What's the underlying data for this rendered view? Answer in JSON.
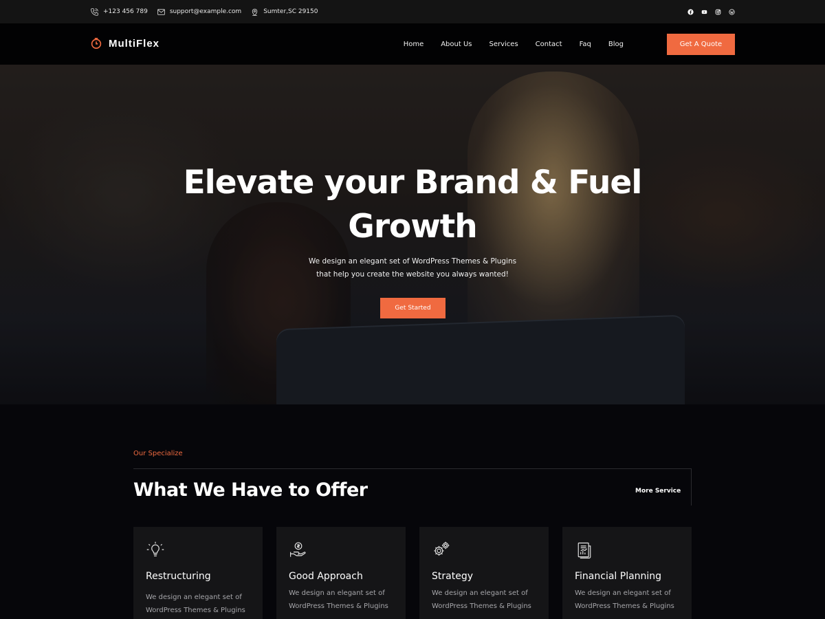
{
  "topbar": {
    "phone": "+123 456 789",
    "email": "support@example.com",
    "address": "Sumter,SC 29150",
    "social_icons": [
      "facebook-icon",
      "youtube-icon",
      "instagram-icon",
      "wordpress-icon"
    ]
  },
  "header": {
    "brand": "MultiFlex",
    "nav": [
      "Home",
      "About Us",
      "Services",
      "Contact",
      "Faq",
      "Blog"
    ],
    "cta_label": "Get A Quote"
  },
  "hero": {
    "title_line1": "Elevate your Brand & Fuel",
    "title_line2": "Growth",
    "subtitle_line1": "We design an elegant set of WordPress Themes & Plugins",
    "subtitle_line2": "that help you create the website you always wanted!",
    "button_label": "Get Started"
  },
  "services": {
    "eyebrow": "Our Specialize",
    "title": "What We Have to Offer",
    "more_label": "More Service",
    "cards": [
      {
        "title": "Restructuring",
        "desc_line1": "We design an elegant set of",
        "desc_line2": "WordPress Themes & Plugins",
        "icon": "lightbulb-icon"
      },
      {
        "title": "Good Approach",
        "desc_line1": "We design an elegant set of",
        "desc_line2": "WordPress Themes & Plugins",
        "icon": "money-hand-icon"
      },
      {
        "title": "Strategy",
        "desc_line1": "We design an elegant set of",
        "desc_line2": "WordPress Themes & Plugins",
        "icon": "gears-icon"
      },
      {
        "title": "Financial Planning",
        "desc_line1": "We design an elegant set of",
        "desc_line2": "WordPress Themes & Plugins",
        "icon": "report-icon"
      }
    ]
  },
  "colors": {
    "accent": "#f06a40",
    "topbar_bg": "#141414",
    "header_bg": "#020203",
    "page_bg": "#06060a",
    "card_bg": "#151517"
  }
}
